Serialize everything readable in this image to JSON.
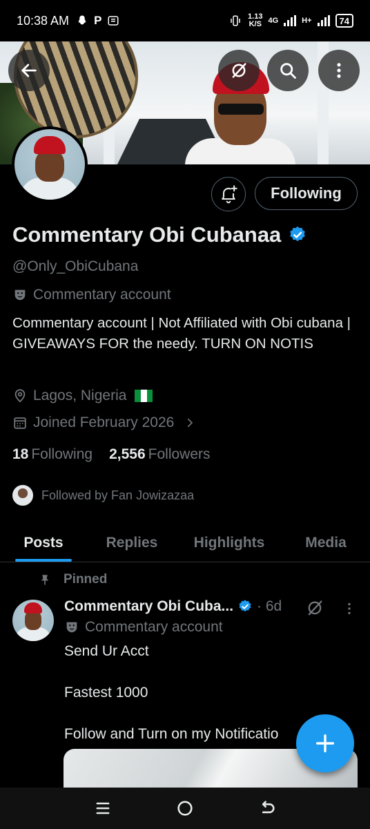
{
  "status_bar": {
    "time": "10:38 AM",
    "app_icons": [
      "snapchat-icon",
      "p-icon",
      "messages-icon"
    ],
    "net_speed": "1.13",
    "net_unit": "K/S",
    "network_4g": "4G",
    "network_h": "H+",
    "battery": "74"
  },
  "banner": {
    "actions": [
      "back-icon",
      "grok-icon",
      "search-icon",
      "more-icon"
    ]
  },
  "profile": {
    "display_name": "Commentary Obi Cubanaa",
    "handle": "@Only_ObiCubana",
    "account_label": "Commentary account",
    "bio": "Commentary account | Not Affiliated with Obi cubana | GIVEAWAYS FOR the needy. TURN ON NOTIS",
    "location": "Lagos, Nigeria",
    "joined": "Joined February 2026",
    "following_count": "18",
    "following_label": "Following",
    "followers_count": "2,556",
    "followers_label": "Followers",
    "followed_by": "Followed by Fan Jowizazaa",
    "follow_button": "Following",
    "verified_color": "#1d9bf0"
  },
  "tabs": [
    {
      "label": "Posts",
      "active": true
    },
    {
      "label": "Replies",
      "active": false
    },
    {
      "label": "Highlights",
      "active": false
    },
    {
      "label": "Media",
      "active": false
    }
  ],
  "post": {
    "pinned_label": "Pinned",
    "author": "Commentary Obi Cuba...",
    "time": "· 6d",
    "account_label": "Commentary account",
    "body": "Send Ur Acct\n\nFastest 1000\n\nFollow and Turn on my Notificatio"
  },
  "colors": {
    "accent": "#1d9bf0",
    "text_primary": "#e7e9ea",
    "text_secondary": "#71767b",
    "background": "#000000"
  }
}
